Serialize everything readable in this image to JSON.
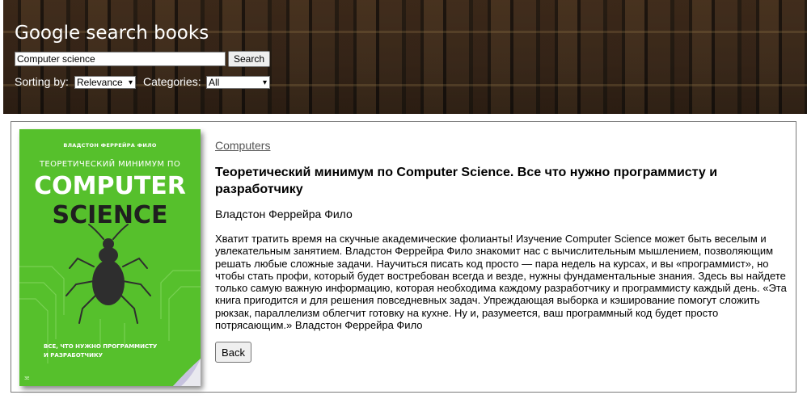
{
  "header": {
    "title": "Google search books",
    "search_value": "Computer science",
    "search_button": "Search",
    "sort_label": "Sorting by:",
    "sort_selected": "Relevance",
    "categories_label": "Categories:",
    "categories_selected": "All"
  },
  "book": {
    "category": "Computers",
    "title": "Теоретический минимум по Computer Science. Все что нужно программисту и разработчику",
    "author": "Владстон Феррейра Фило",
    "description": "Хватит тратить время на скучные академические фолианты! Изучение Computer Science может быть веселым и увлекательным занятием. Владстон Феррейра Фило знакомит нас с вычислительным мышлением, позволяющим решать любые сложные задачи. Научиться писать код просто — пара недель на курсах, и вы «программист», но чтобы стать профи, который будет востребован всегда и везде, нужны фундаментальные знания. Здесь вы найдете только самую важную информацию, которая необходима каждому разработчику и программисту каждый день. «Эта книга пригодится и для решения повседневных задач. Упреждающая выборка и кэширование помогут сложить рюкзак, параллелизм облегчит готовку на кухне. Ну и, разумеется, ваш программный код будет просто потрясающим.» Владстон Феррейра Фило",
    "cover": {
      "author": "ВЛАДСТОН ФЕРРЕЙРА ФИЛО",
      "subtitle": "ТЕОРЕТИЧЕСКИЙ МИНИМУМ ПО",
      "title_line1": "COMPUTER",
      "title_line2": "SCIENCE",
      "tagline_line1": "ВСЕ, ЧТО НУЖНО ПРОГРАММИСТУ",
      "tagline_line2": "И РАЗРАБОТЧИКУ",
      "background": "#56c02c"
    }
  },
  "actions": {
    "back_button": "Back"
  },
  "icons": {
    "select_arrow": "chevron-down-icon"
  }
}
